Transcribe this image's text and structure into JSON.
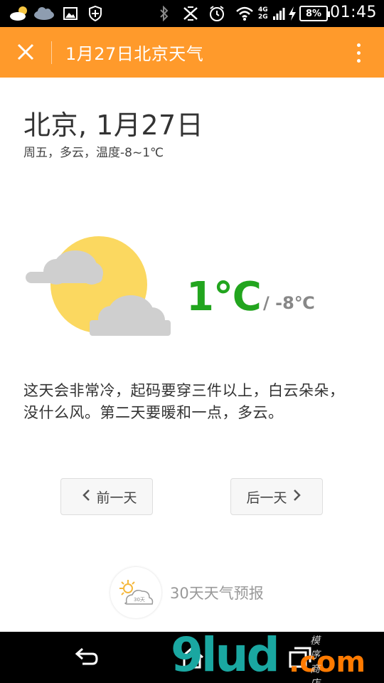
{
  "status_bar": {
    "time": "01:45",
    "battery": "8%",
    "network_top": "4G",
    "network_bottom": "2G",
    "icons": [
      "weather-cloud-icon",
      "cloud-icon",
      "image-icon",
      "shield-icon",
      "bluetooth-icon",
      "mute-icon",
      "alarm-icon",
      "wifi-icon",
      "signal-icon",
      "charging-icon"
    ]
  },
  "action_bar": {
    "title": "1月27日北京天气",
    "background": "#ff9a2b"
  },
  "header": {
    "title": "北京, 1月27日",
    "summary": "周五，多云，温度-8~1℃"
  },
  "weather": {
    "condition_icon": "partly-cloudy-icon",
    "high": "1℃",
    "low": "/ -8℃",
    "high_color": "#22a51e"
  },
  "description": "这天会非常冷，起码要穿三件以上，白云朵朵，没什么风。第二天要暖和一点，多云。",
  "navigation": {
    "prev_label": "前一天",
    "next_label": "后一天"
  },
  "forecast": {
    "badge": "30天",
    "label": "30天天气预报"
  },
  "watermark": {
    "brand": "9lud",
    "domain": ".com",
    "tagline": "模 序 商 店"
  }
}
